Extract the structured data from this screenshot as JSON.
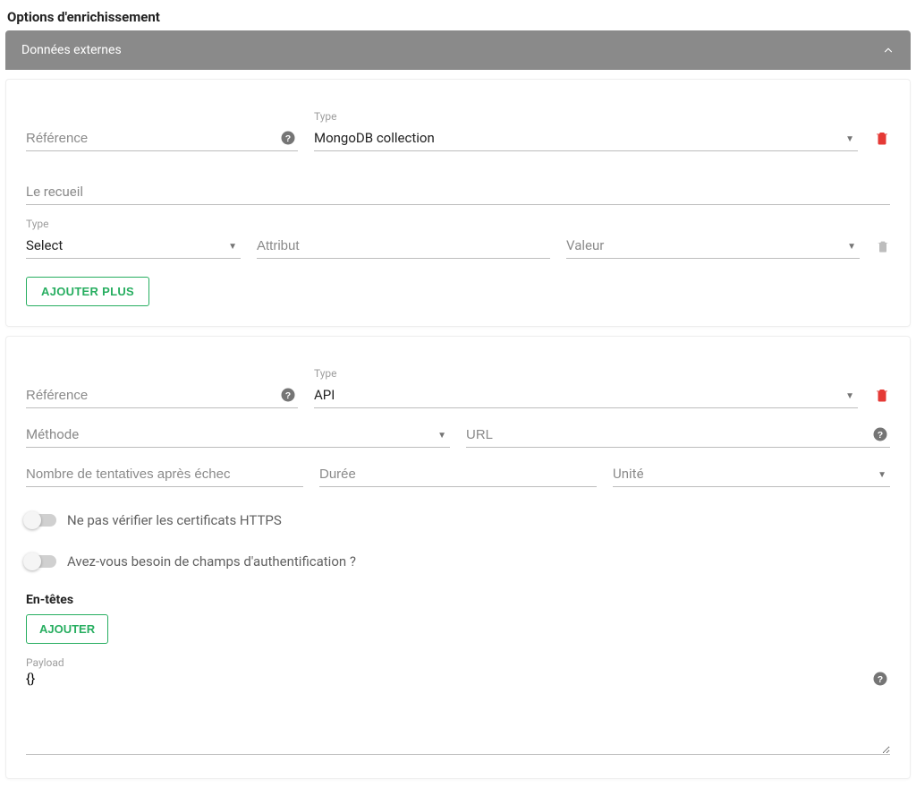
{
  "page": {
    "title": "Options d'enrichissement",
    "accordion_label": "Données externes"
  },
  "card1": {
    "reference_label": "Référence",
    "type_label": "Type",
    "type_value": "MongoDB collection",
    "collection_label": "Le recueil",
    "filter": {
      "type_label": "Type",
      "type_value": "Select",
      "attribute_label": "Attribut",
      "value_label": "Valeur"
    },
    "add_more_label": "AJOUTER PLUS"
  },
  "card2": {
    "reference_label": "Référence",
    "type_label": "Type",
    "type_value": "API",
    "method_label": "Méthode",
    "url_label": "URL",
    "retries_label": "Nombre de tentatives après échec",
    "duration_label": "Durée",
    "unit_label": "Unité",
    "toggle_verify_https_label": "Ne pas vérifier les certificats HTTPS",
    "toggle_auth_label": "Avez-vous besoin de champs d'authentification ?",
    "headers_heading": "En-têtes",
    "add_label": "AJOUTER",
    "payload_label": "Payload",
    "payload_value": "{}"
  }
}
